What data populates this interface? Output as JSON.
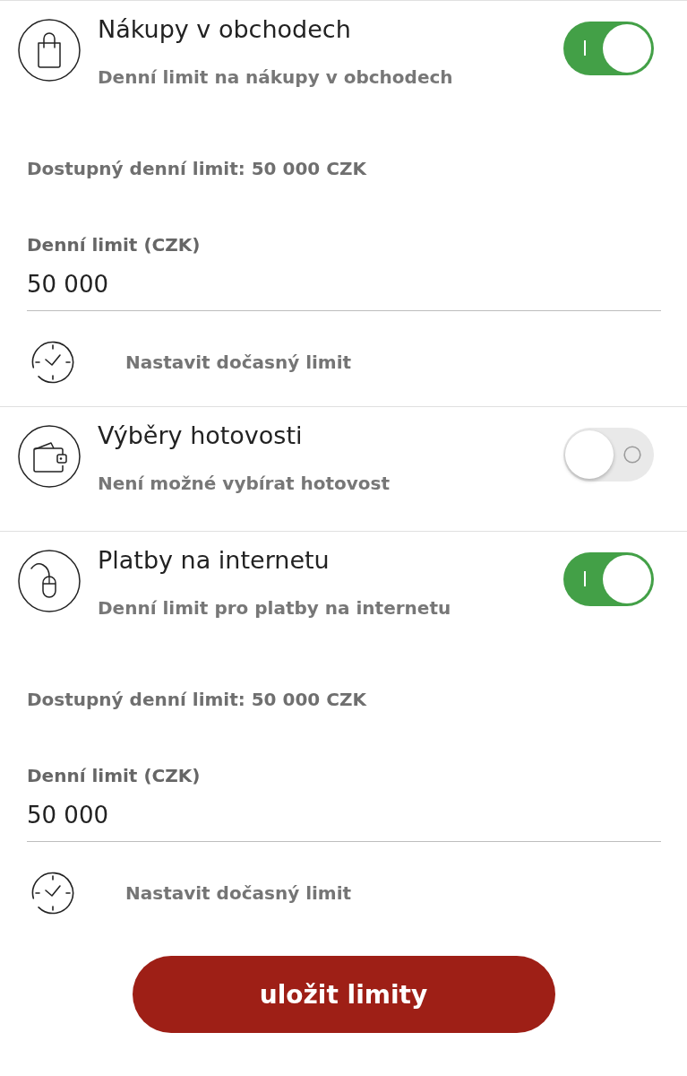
{
  "sections": [
    {
      "kind": "shop",
      "title": "Nákupy v obchodech",
      "subtitle": "Denní limit na nákupy v obchodech",
      "on": true,
      "available": "Dostupný denní limit: 50 000 CZK",
      "limit_field": {
        "label": "Denní limit (CZK)",
        "value": "50 000"
      },
      "temporary_limit_link": "Nastavit dočasný limit"
    },
    {
      "kind": "cash",
      "title": "Výběry hotovosti",
      "subtitle": "Není možné vybírat hotovost",
      "on": false
    },
    {
      "kind": "internet",
      "title": "Platby na internetu",
      "subtitle": "Denní limit pro platby na internetu",
      "on": true,
      "available": "Dostupný denní limit: 50 000 CZK",
      "limit_field": {
        "label": "Denní limit (CZK)",
        "value": "50 000"
      },
      "temporary_limit_link": "Nastavit dočasný limit"
    }
  ],
  "save_button": "uložit limity"
}
